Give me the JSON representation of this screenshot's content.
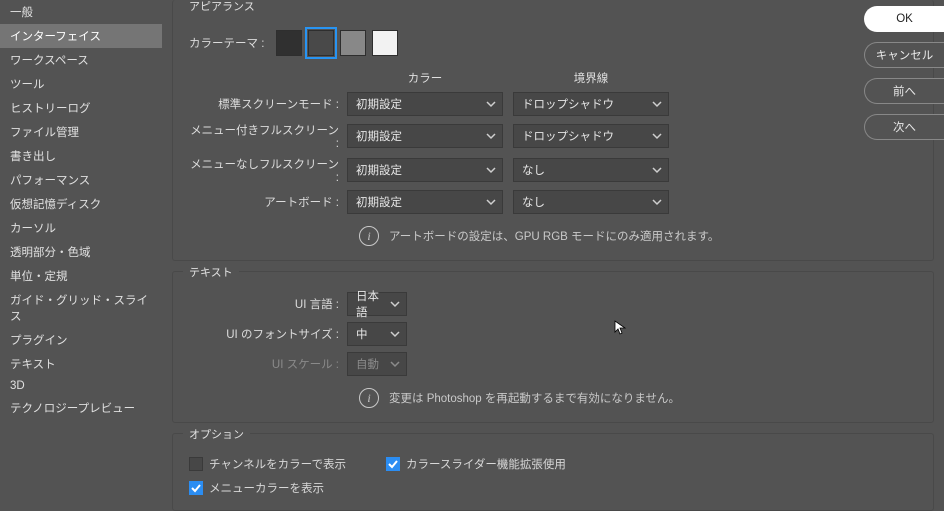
{
  "sidebar": {
    "items": [
      {
        "label": "一般"
      },
      {
        "label": "インターフェイス"
      },
      {
        "label": "ワークスペース"
      },
      {
        "label": "ツール"
      },
      {
        "label": "ヒストリーログ"
      },
      {
        "label": "ファイル管理"
      },
      {
        "label": "書き出し"
      },
      {
        "label": "パフォーマンス"
      },
      {
        "label": "仮想記憶ディスク"
      },
      {
        "label": "カーソル"
      },
      {
        "label": "透明部分・色域"
      },
      {
        "label": "単位・定規"
      },
      {
        "label": "ガイド・グリッド・スライス"
      },
      {
        "label": "プラグイン"
      },
      {
        "label": "テキスト"
      },
      {
        "label": "3D"
      },
      {
        "label": "テクノロジープレビュー"
      }
    ],
    "active_index": 1
  },
  "appearance": {
    "title": "アピアランス",
    "color_theme_label": "カラーテーマ :",
    "swatches": [
      "#303030",
      "#494949",
      "#888888",
      "#f2f2f2"
    ],
    "selected_swatch": 1,
    "col_color": "カラー",
    "col_border": "境界線",
    "rows": [
      {
        "label": "標準スクリーンモード :",
        "color": "初期設定",
        "border": "ドロップシャドウ"
      },
      {
        "label": "メニュー付きフルスクリーン :",
        "color": "初期設定",
        "border": "ドロップシャドウ"
      },
      {
        "label": "メニューなしフルスクリーン :",
        "color": "初期設定",
        "border": "なし"
      },
      {
        "label": "アートボード :",
        "color": "初期設定",
        "border": "なし"
      }
    ],
    "info": "アートボードの設定は、GPU RGB モードにのみ適用されます。"
  },
  "text": {
    "title": "テキスト",
    "ui_lang_label": "UI 言語 :",
    "ui_lang_value": "日本語",
    "ui_font_label": "UI のフォントサイズ :",
    "ui_font_value": "中",
    "ui_scale_label": "UI スケール :",
    "ui_scale_value": "自動",
    "info": "変更は Photoshop を再起動するまで有効になりません。"
  },
  "options": {
    "title": "オプション",
    "show_channels": "チャンネルをカラーで表示",
    "color_slider": "カラースライダー機能拡張使用",
    "menu_color": "メニューカラーを表示"
  },
  "buttons": {
    "ok": "OK",
    "cancel": "キャンセル",
    "prev": "前へ",
    "next": "次へ"
  }
}
